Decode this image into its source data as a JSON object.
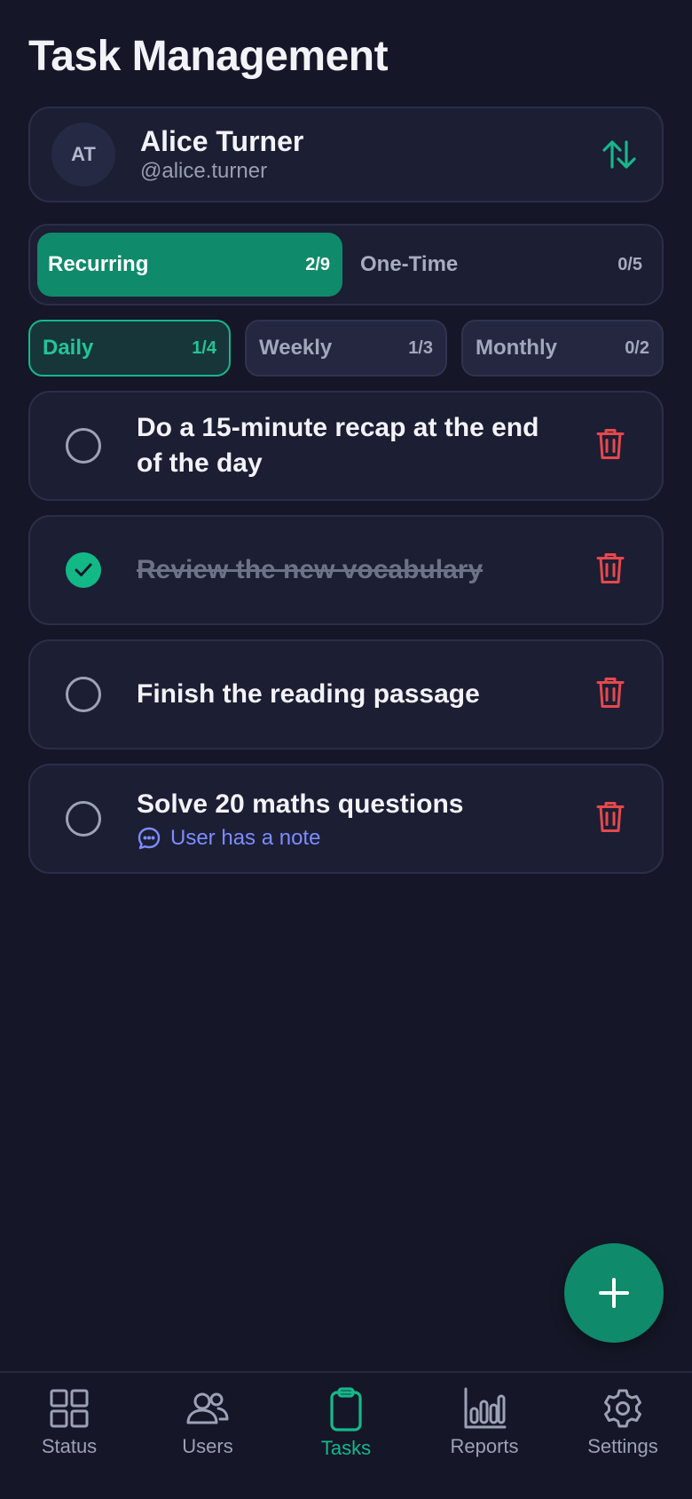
{
  "header": {
    "title": "Task Management"
  },
  "user": {
    "initials": "AT",
    "name": "Alice Turner",
    "handle": "@alice.turner"
  },
  "type_tabs": [
    {
      "label": "Recurring",
      "count": "2/9",
      "active": true
    },
    {
      "label": "One-Time",
      "count": "0/5",
      "active": false
    }
  ],
  "period_tabs": [
    {
      "label": "Daily",
      "count": "1/4",
      "active": true
    },
    {
      "label": "Weekly",
      "count": "1/3",
      "active": false
    },
    {
      "label": "Monthly",
      "count": "0/2",
      "active": false
    }
  ],
  "tasks": [
    {
      "text": "Do a 15-minute recap at the end of the day",
      "done": false
    },
    {
      "text": "Review the new vocabulary",
      "done": true
    },
    {
      "text": "Finish the reading passage",
      "done": false
    },
    {
      "text": "Solve 20 maths questions",
      "done": false,
      "note": "User has a note"
    }
  ],
  "nav": [
    {
      "label": "Status",
      "icon": "grid-icon"
    },
    {
      "label": "Users",
      "icon": "users-icon"
    },
    {
      "label": "Tasks",
      "icon": "clipboard-icon",
      "active": true
    },
    {
      "label": "Reports",
      "icon": "bar-chart-icon"
    },
    {
      "label": "Settings",
      "icon": "gear-icon"
    }
  ],
  "colors": {
    "accent": "#0f8a6a",
    "accent_light": "#14b88a",
    "danger": "#e5484d",
    "note": "#7d8cff",
    "background": "#151728"
  }
}
